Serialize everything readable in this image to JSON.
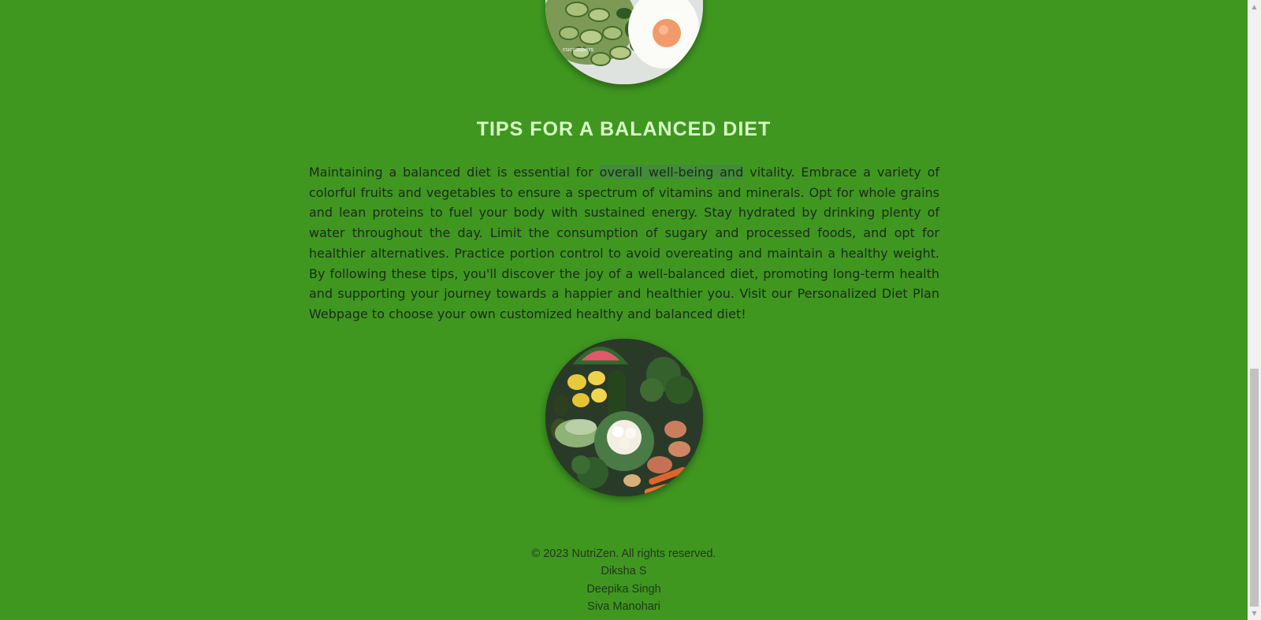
{
  "tips": {
    "heading": "TIPS FOR A BALANCED DIET",
    "paragraph_before": "Maintaining a balanced diet is essential for ",
    "paragraph_highlight": "overall well-being and",
    "paragraph_after": " vitality. Embrace a variety of colorful fruits and vegetables to ensure a spectrum of vitamins and minerals. Opt for whole grains and lean proteins to fuel your body with sustained energy. Stay hydrated by drinking plenty of water throughout the day. Limit the consumption of sugary and processed foods, and opt for healthier alternatives. Practice portion control to avoid overeating and maintain a healthy weight. By following these tips, you'll discover the joy of a well-balanced diet, promoting long-term health and supporting your journey towards a happier and healthier you. Visit our Personalized Diet Plan Webpage to choose your own customized healthy and balanced diet!"
  },
  "images": {
    "top_plate_labels": [
      "cucumbers",
      "eggs"
    ]
  },
  "footer": {
    "copyright": "© 2023 NutriZen. All rights reserved.",
    "authors": [
      "Diksha S",
      "Deepika Singh",
      "Siva Manohari"
    ]
  },
  "colors": {
    "background": "#3f9720",
    "heading": "#d8ffc6",
    "body_text": "#1e2a1b"
  }
}
